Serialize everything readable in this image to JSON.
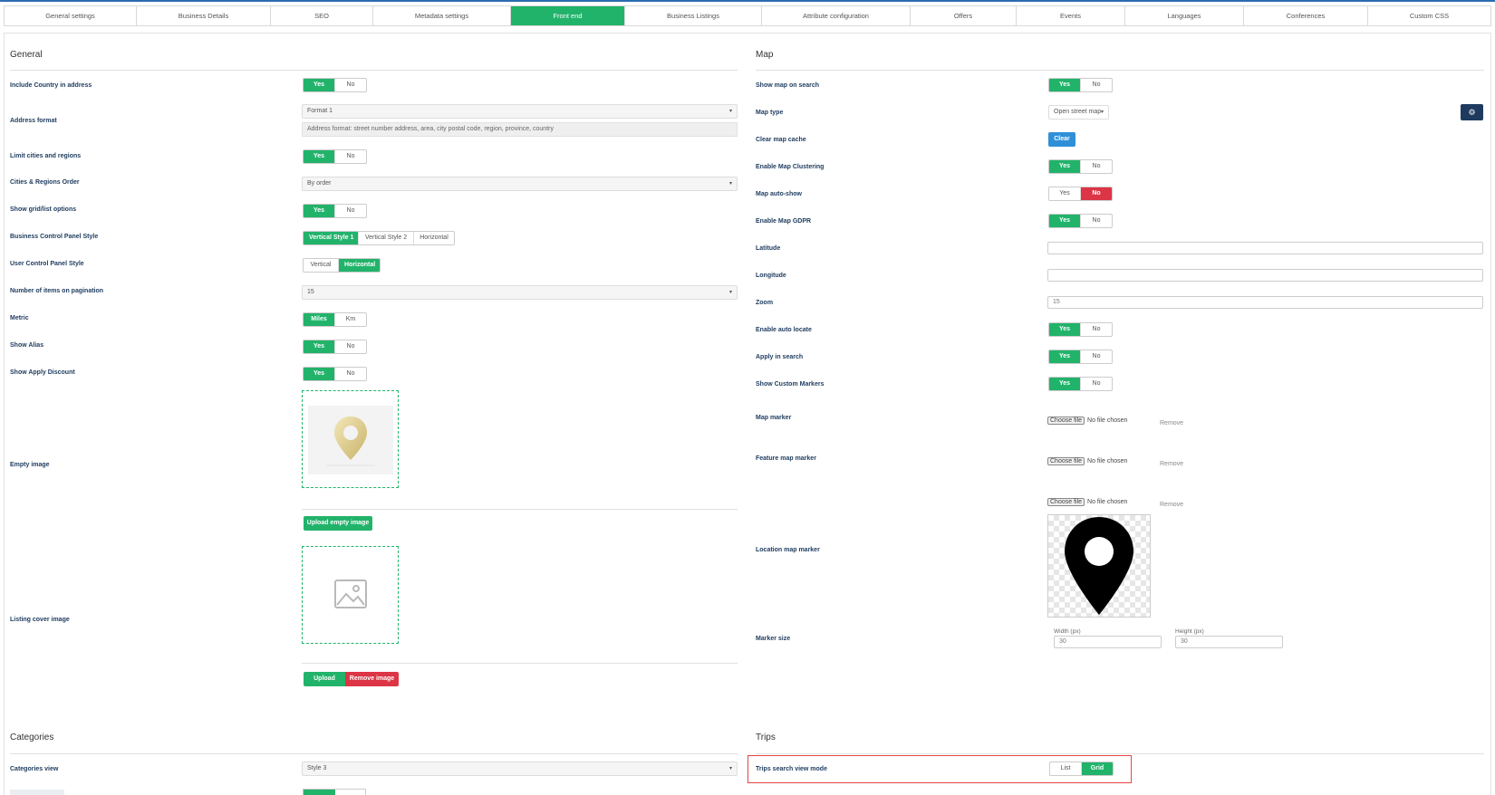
{
  "tabs": [
    "General settings",
    "Business Details",
    "SEO",
    "Metadata settings",
    "Front end",
    "Business Listings",
    "Attribute configuration",
    "Offers",
    "Events",
    "Languages",
    "Conferences",
    "Custom CSS"
  ],
  "general": {
    "title": "General",
    "include_country": {
      "label": "Include Country in address",
      "yes": "Yes",
      "no": "No"
    },
    "address_format": {
      "label": "Address format",
      "value": "Format 1",
      "note": "Address format: street number address, area, city postal code, region, province, country"
    },
    "limit_cities": {
      "label": "Limit cities and regions",
      "yes": "Yes",
      "no": "No"
    },
    "cities_order": {
      "label": "Cities & Regions Order",
      "value": "By order"
    },
    "show_grid": {
      "label": "Show grid/list options",
      "yes": "Yes",
      "no": "No"
    },
    "business_cp": {
      "label": "Business Control Panel Style",
      "options": [
        "Vertical Style 1",
        "Vertical Style 2",
        "Horizontal"
      ]
    },
    "user_cp": {
      "label": "User Control Panel Style",
      "options": [
        "Vertical",
        "Horizontal"
      ]
    },
    "pagination": {
      "label": "Number of items on pagination",
      "value": "15"
    },
    "metric": {
      "label": "Metric",
      "options": [
        "Miles",
        "Km"
      ]
    },
    "show_alias": {
      "label": "Show Alias",
      "yes": "Yes",
      "no": "No"
    },
    "show_discount": {
      "label": "Show Apply Discount",
      "yes": "Yes",
      "no": "No"
    },
    "empty_image": {
      "label": "Empty image",
      "upload": "Upload empty image"
    },
    "cover_image": {
      "label": "Listing cover image",
      "upload": "Upload",
      "remove": "Remove image"
    }
  },
  "map": {
    "title": "Map",
    "show_on_search": {
      "label": "Show map on search",
      "yes": "Yes",
      "no": "No"
    },
    "map_type": {
      "label": "Map type",
      "value": "Open street map"
    },
    "clear_cache": {
      "label": "Clear map cache",
      "button": "Clear"
    },
    "clustering": {
      "label": "Enable Map Clustering",
      "yes": "Yes",
      "no": "No"
    },
    "auto_show": {
      "label": "Map auto-show",
      "yes": "Yes",
      "no": "No"
    },
    "gdpr": {
      "label": "Enable Map GDPR",
      "yes": "Yes",
      "no": "No"
    },
    "latitude": {
      "label": "Latitude",
      "value": ""
    },
    "longitude": {
      "label": "Longitude",
      "value": ""
    },
    "zoom": {
      "label": "Zoom",
      "value": "15"
    },
    "auto_locate": {
      "label": "Enable auto locate",
      "yes": "Yes",
      "no": "No"
    },
    "apply_search": {
      "label": "Apply in search",
      "yes": "Yes",
      "no": "No"
    },
    "custom_markers": {
      "label": "Show Custom Markers",
      "yes": "Yes",
      "no": "No"
    },
    "file_choose": "Choose file",
    "file_none": "No file chosen",
    "remove": "Remove",
    "map_marker": {
      "label": "Map marker"
    },
    "feature_marker": {
      "label": "Feature map marker"
    },
    "location_marker": {
      "label": "Location map marker"
    },
    "marker_size": {
      "label": "Marker size",
      "width_label": "Width (px)",
      "width_value": "30",
      "height_label": "Height (px)",
      "height_value": "30"
    }
  },
  "categories": {
    "title": "Categories",
    "view": {
      "label": "Categories view",
      "value": "Style 3"
    }
  },
  "trips": {
    "title": "Trips",
    "view_mode": {
      "label": "Trips search view mode",
      "options": [
        "List",
        "Grid"
      ]
    }
  },
  "colors": {
    "accent": "#22b36b",
    "danger": "#dc3545",
    "info": "#2f90d8",
    "navy": "#1f3a5f",
    "label": "#1d3b5e"
  }
}
